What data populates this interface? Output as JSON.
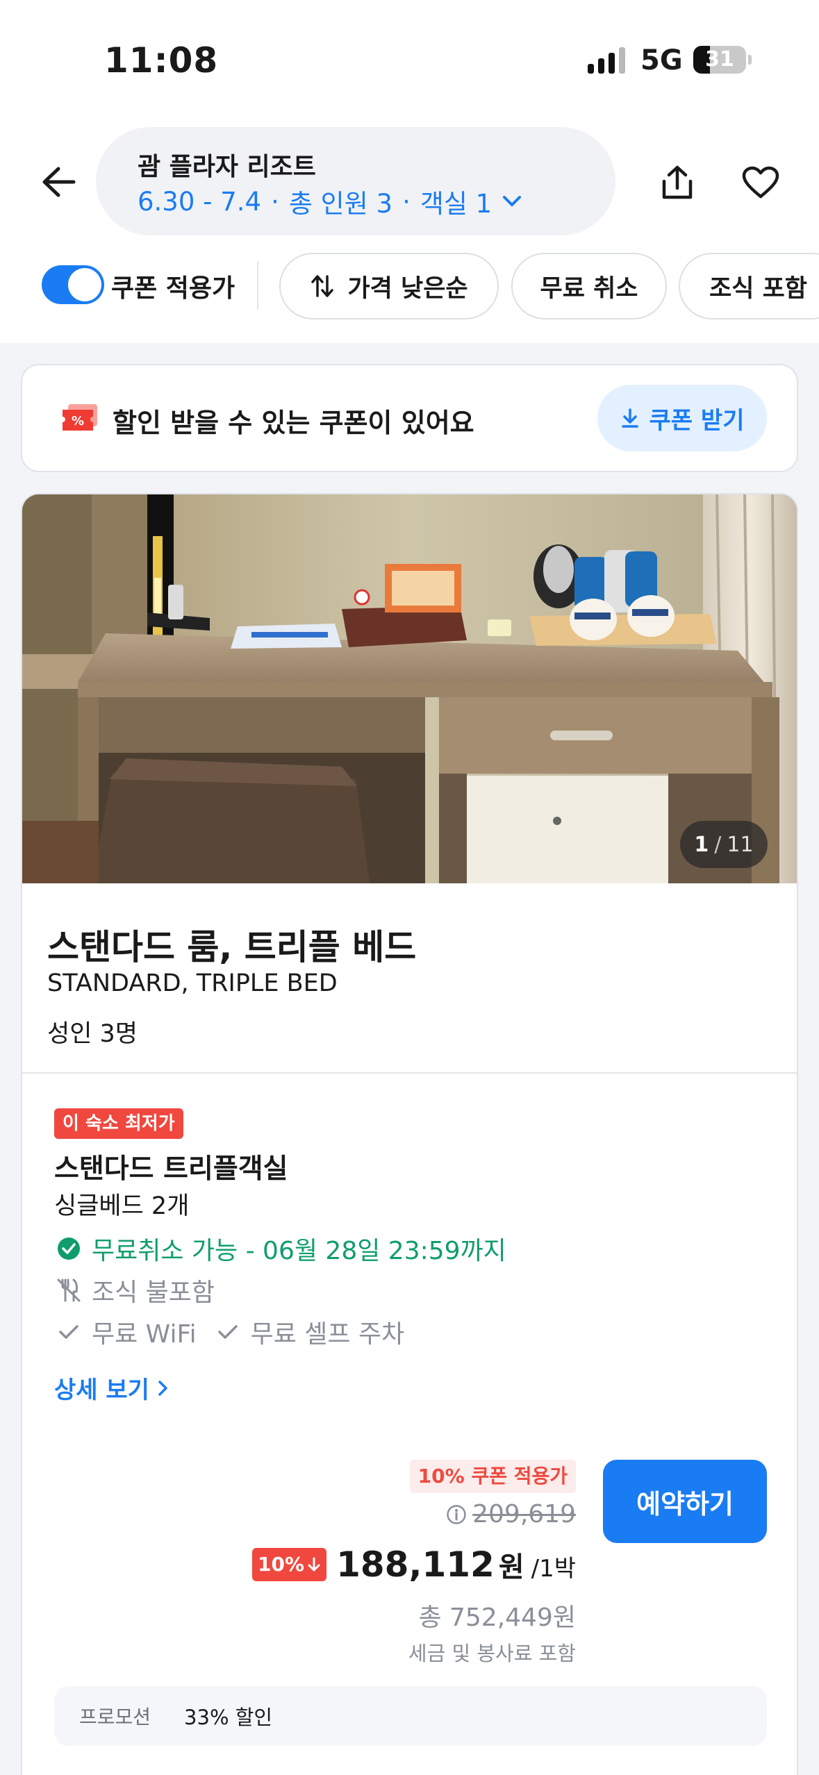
{
  "status_bar": {
    "time": "11:08",
    "network": "5G",
    "battery_level": "31",
    "battery_fraction": 0.31
  },
  "header": {
    "hotel_name": "괌 플라자 리조트",
    "dates": "6.30 - 7.4",
    "guests": "총 인원 3",
    "rooms": "객실 1",
    "separator": "·"
  },
  "filters": {
    "coupon_toggle_label": "쿠폰 적용가",
    "coupon_toggle_on": true,
    "sort_label": "가격 낮은순",
    "free_cancel_label": "무료 취소",
    "breakfast_label": "조식 포함"
  },
  "coupon_banner": {
    "text": "할인 받을 수 있는 쿠폰이 있어요",
    "button": "쿠폰 받기",
    "ticket_symbol": "%"
  },
  "room": {
    "photo_index": "1",
    "photo_sep": "/",
    "photo_total": "11",
    "title": "스탠다드 룸, 트리플 베드",
    "subtitle": "STANDARD, TRIPLE BED",
    "occupancy": "성인 3명",
    "plan": {
      "badge": "이 숙소 최저가",
      "name": "스탠다드 트리플객실",
      "bed": "싱글베드 2개",
      "cancel_text": "무료취소 가능 - 06월 28일 23:59까지",
      "breakfast_text": "조식 불포함",
      "amenities": [
        "무료 WiFi",
        "무료 셀프 주차"
      ],
      "detail_link": "상세 보기"
    },
    "pricing": {
      "coupon_applied": "10% 쿠폰 적용가",
      "original_price": "209,619",
      "discount_badge": "10%",
      "price": "188,112",
      "currency": "원",
      "per_night": "/1박",
      "total": "총 752,449원",
      "tax_note": "세금 및 봉사료 포함"
    },
    "book_button": "예약하기",
    "promotion": {
      "label": "프로모션",
      "value": "33% 할인"
    }
  },
  "colors": {
    "accent": "#1a7cf2",
    "red": "#f0483e",
    "green": "#0f9d6b",
    "gray": "#8a8f98"
  }
}
